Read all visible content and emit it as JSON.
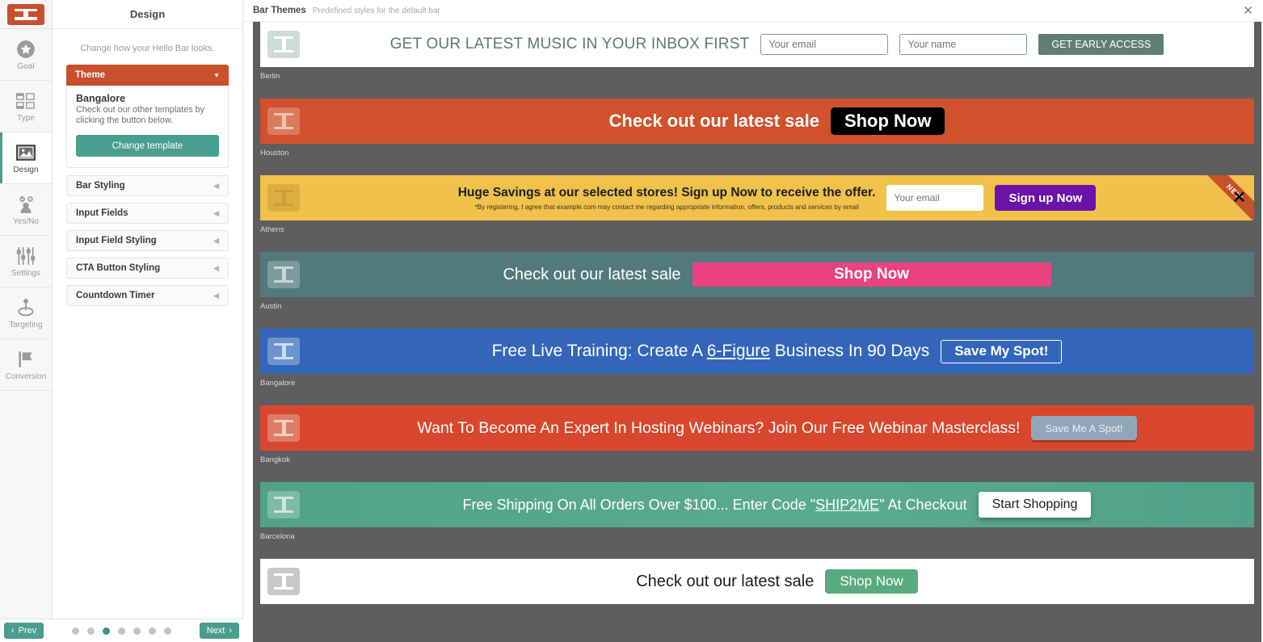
{
  "rail": {
    "logo_name": "hello-bar-logo",
    "items": [
      {
        "label": "Goal",
        "icon": "star-badge-icon",
        "active": false
      },
      {
        "label": "Type",
        "icon": "layout-grid-icon",
        "active": false
      },
      {
        "label": "Design",
        "icon": "image-icon",
        "active": true
      },
      {
        "label": "Yes/No",
        "icon": "user-choice-icon",
        "active": false
      },
      {
        "label": "Settings",
        "icon": "sliders-icon",
        "active": false
      },
      {
        "label": "Targeting",
        "icon": "target-pin-icon",
        "active": false
      },
      {
        "label": "Conversion",
        "icon": "flag-icon",
        "active": false
      }
    ]
  },
  "panel": {
    "title": "Design",
    "subtitle": "Change how your Hello Bar looks.",
    "theme_section": {
      "header": "Theme",
      "template_name": "Bangalore",
      "template_desc": "Check out our other templates by clicking the button below.",
      "change_button": "Change template"
    },
    "sections": [
      {
        "label": "Bar Styling"
      },
      {
        "label": "Input Fields"
      },
      {
        "label": "Input Field Styling"
      },
      {
        "label": "CTA Button Styling"
      },
      {
        "label": "Countdown Timer"
      }
    ]
  },
  "bottom_nav": {
    "prev_label": "Prev",
    "next_label": "Next",
    "dot_count": 7,
    "active_dot_index": 2
  },
  "main": {
    "title": "Bar Themes",
    "subtitle": "Predefined styles for the default bar",
    "close_icon": "close-icon"
  },
  "themes": [
    {
      "name": "Berlin",
      "message": "GET OUR LATEST MUSIC IN YOUR INBOX FIRST",
      "inputs": [
        {
          "placeholder": "Your email"
        },
        {
          "placeholder": "Your name"
        }
      ],
      "cta": "GET EARLY ACCESS",
      "bar_color": "#ffffff",
      "cta_color": "#5f7f75"
    },
    {
      "name": "Houston",
      "message": "Check out our latest sale",
      "cta": "Shop Now",
      "bar_color": "#d0512b",
      "cta_color": "#000000"
    },
    {
      "name": "Athens",
      "message": "Huge Savings at our selected stores! Sign up Now to receive the offer.",
      "fine_print": "*By registering, I agree that example.com may contact me regarding appropriate information, offers, products and services by email",
      "inputs": [
        {
          "placeholder": "Your email"
        }
      ],
      "cta": "Sign up Now",
      "ribbon": "NEW",
      "close": "✕",
      "bar_color": "#f0c14b",
      "cta_color": "#6b12a8"
    },
    {
      "name": "Austin",
      "message": "Check out our latest sale",
      "cta": "Shop Now",
      "bar_color": "#52797d",
      "cta_color": "#e8437e"
    },
    {
      "name": "Bangalore",
      "message_before": "Free Live Training: Create A ",
      "message_underline": "6-Figure",
      "message_after": " Business In 90 Days",
      "cta": "Save My Spot!",
      "bar_color": "#3366bb",
      "cta_color": "#3366bb"
    },
    {
      "name": "Bangkok",
      "message": "Want To Become An Expert In Hosting Webinars? Join Our Free Webinar Masterclass!",
      "cta": "Save Me A Spot!",
      "bar_color": "#d8472d",
      "cta_color": "#91a7b8"
    },
    {
      "name": "Barcelona",
      "message_before": "Free Shipping On All Orders Over $100... Enter Code \"",
      "message_underline": "SHIP2ME",
      "message_after": "\" At Checkout",
      "cta": "Start Shopping",
      "bar_color": "#51a386",
      "cta_color": "#ffffff"
    },
    {
      "name": "",
      "message": "Check out our latest sale",
      "cta": "Shop Now",
      "bar_color": "#ffffff",
      "cta_color": "#57ab7c"
    }
  ]
}
